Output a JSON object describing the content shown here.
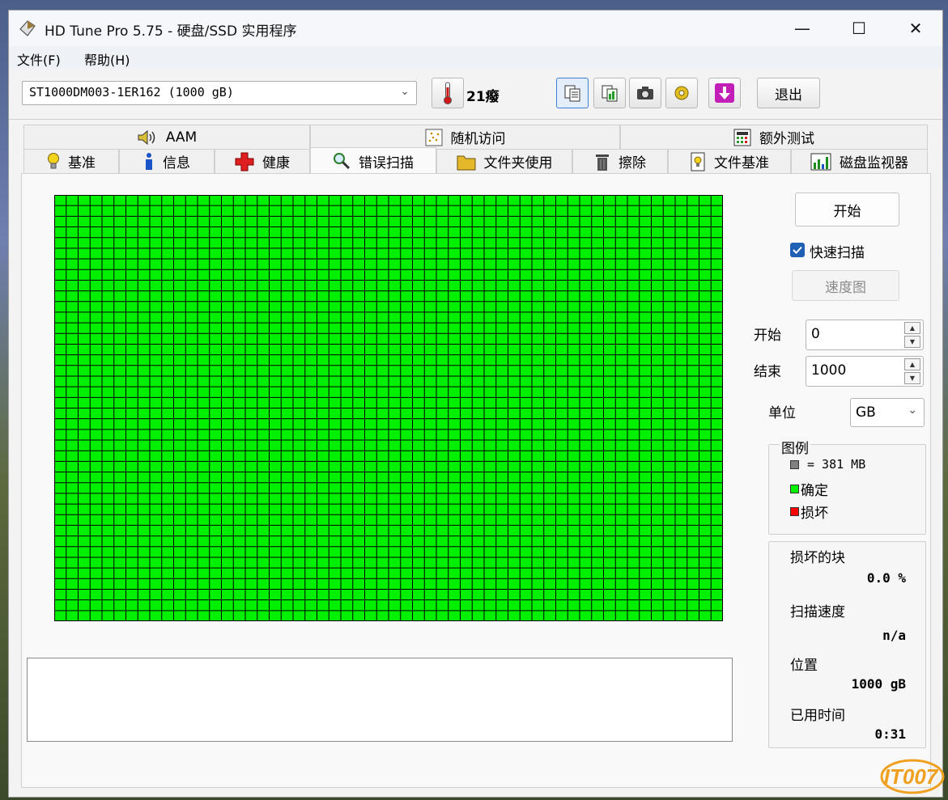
{
  "window": {
    "title": "HD Tune Pro 5.75 - 硬盘/SSD 实用程序",
    "minimize": "—",
    "maximize": "☐",
    "close": "✕"
  },
  "menu": {
    "file": "文件(F)",
    "help": "帮助(H)"
  },
  "toolbar": {
    "drive": "ST1000DM003-1ER162 (1000 gB)",
    "temperature": "21癈",
    "exit_label": "退出"
  },
  "tabs_top": [
    {
      "label": "AAM",
      "icon": "speaker-icon"
    },
    {
      "label": "随机访问",
      "icon": "scatter-icon"
    },
    {
      "label": "额外测试",
      "icon": "calculator-icon"
    }
  ],
  "tabs_bottom": [
    {
      "label": "基准",
      "icon": "bulb-icon"
    },
    {
      "label": "信息",
      "icon": "info-icon"
    },
    {
      "label": "健康",
      "icon": "cross-icon"
    },
    {
      "label": "错误扫描",
      "icon": "magnifier-icon"
    },
    {
      "label": "文件夹使用",
      "icon": "folder-icon"
    },
    {
      "label": "擦除",
      "icon": "trash-icon"
    },
    {
      "label": "文件基准",
      "icon": "file-icon"
    },
    {
      "label": "磁盘监视器",
      "icon": "monitor-icon"
    }
  ],
  "selected_tab": "错误扫描",
  "scan": {
    "start_button": "开始",
    "quick_scan_label": "快速扫描",
    "quick_scan_checked": true,
    "speed_map_button": "速度图",
    "range_start_label": "开始",
    "range_start_value": "0",
    "range_end_label": "结束",
    "range_end_value": "1000",
    "unit_label": "单位",
    "unit_value": "GB",
    "grid_rows": 40,
    "grid_cols": 56,
    "block_status": "ok"
  },
  "legend": {
    "title": "图例",
    "block_size": "= 381 MB",
    "ok": "确定",
    "damaged": "损坏"
  },
  "stats": {
    "damaged_blocks_label": "损坏的块",
    "damaged_blocks_value": "0.0 %",
    "scan_speed_label": "扫描速度",
    "scan_speed_value": "n/a",
    "position_label": "位置",
    "position_value": "1000 gB",
    "elapsed_label": "已用时间",
    "elapsed_value": "0:31"
  },
  "colors": {
    "ok": "#00f000",
    "damaged": "#ff0000",
    "block_size": "#808080",
    "accent": "#1f5fb4"
  },
  "watermark": "IT007"
}
